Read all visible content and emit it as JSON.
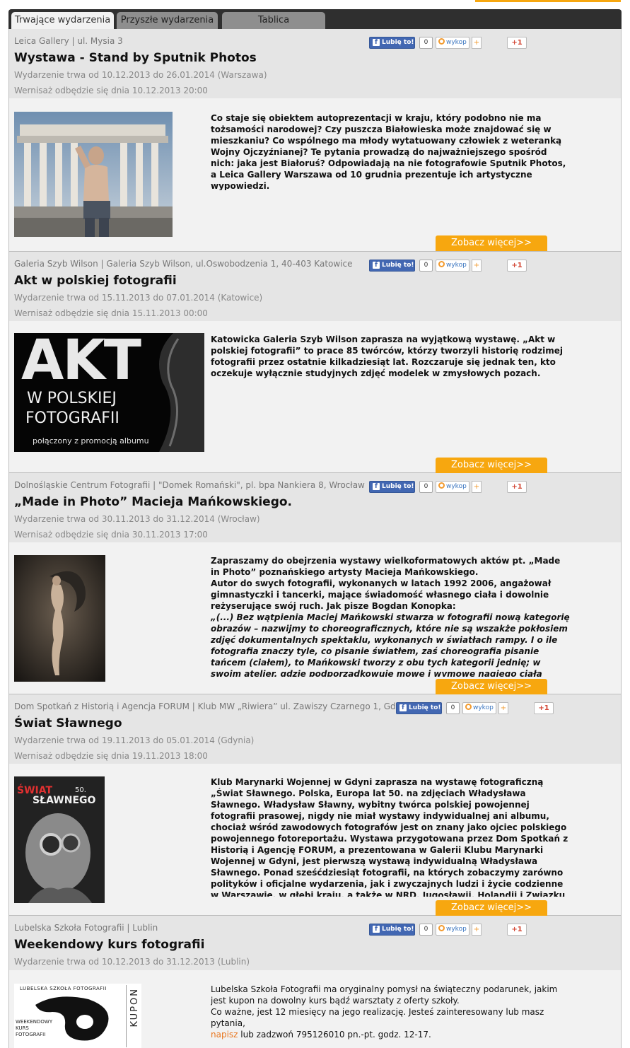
{
  "tabs": [
    "Trwające wydarzenia",
    "Przyszłe wydarzenia",
    "Tablica"
  ],
  "social": {
    "like": "Lubię to!",
    "count": "0",
    "wykop": "wykop",
    "plus": "+",
    "gplus": "+1"
  },
  "more_label": "Zobacz więcej>>",
  "events": [
    {
      "place": "Leica Gallery | ul. Mysia 3",
      "title": "Wystawa - Stand by Sputnik Photos",
      "date": "Wydarzenie trwa od 10.12.2013 do 26.01.2014 (Warszawa)",
      "vernissage": "Wernisaż odbędzie się dnia 10.12.2013 20:00",
      "desc": "Co staje się obiektem autoprezentacji w kraju, który podobno nie ma tożsamości narodowej? Czy puszcza Białowieska może znajdować się w mieszkaniu? Co wspólnego ma młody wytatuowany człowiek z weteranką Wojny Ojczyźnianej? Te pytania prowadzą do najważniejszego spośród nich: jaka jest Białoruś? Odpowiadają na nie fotografowie Sputnik Photos, a Leica Gallery Warszawa od 10 grudnia prezentuje ich artystyczne wypowiedzi."
    },
    {
      "place": "Galeria Szyb Wilson | Galeria Szyb Wilson, ul.Oswobodzenia 1, 40-403 Katowice",
      "title": "Akt w polskiej fotografii",
      "date": "Wydarzenie trwa od 15.11.2013 do 07.01.2014 (Katowice)",
      "vernissage": "Wernisaż odbędzie się dnia 15.11.2013 00:00",
      "desc": "Katowicka Galeria Szyb Wilson zaprasza na wyjątkową wystawę. „Akt w polskiej fotografii” to prace 85 twórców, którzy tworzyli historię rodzimej fotografii przez ostatnie kilkadziesiąt lat. Rozczaruje się jednak ten, kto oczekuje wyłącznie studyjnych zdjęć modelek w zmysłowych pozach.",
      "poster": {
        "l1": "AKT",
        "l2": "W POLSKIEJ",
        "l3": "FOTOGRAFII",
        "l4": "połączony z promocją albumu"
      }
    },
    {
      "place": "Dolnośląskie Centrum Fotografii | \"Domek Romański\", pl. bpa Nankiera 8, Wrocław",
      "title": "„Made in Photo” Macieja Mańkowskiego.",
      "date": "Wydarzenie trwa od 30.11.2013 do 31.12.2014 (Wrocław)",
      "vernissage": "Wernisaż odbędzie się dnia 30.11.2013 17:00",
      "desc_a": "Zapraszamy do obejrzenia wystawy wielkoformatowych aktów pt. „Made in Photo” poznańskiego artysty Macieja Mańkowskiego.",
      "desc_b": "Autor do swych fotografii, wykonanych w latach 1992 2006, angażował gimnastyczki i tancerki, mające świadomość własnego ciała i dowolnie reżyserujące swój ruch. Jak pisze Bogdan Konopka:",
      "desc_c": "„(...) Bez wątpienia Maciej Mańkowski stwarza w fotografii nową kategorię obrazów – nazwijmy to choreograficznych, które nie są wszakże pokłosiem zdjęć dokumentalnych spektaklu, wykonanych w światłach rampy. I o ile fotografia znaczy tyle, co pisanie światłem, zaś choreografia pisanie tańcem (ciałem), to Mańkowski tworzy z obu tych kategorii jednię; w swoim atelier, gdzie podporządkowuje mowę i wymowę nagiego ciała regułom fotografii"
    },
    {
      "place": "Dom Spotkań z Historią i Agencja FORUM | Klub MW „Riwiera” ul. Zawiszy Czarnego 1, Gdynia",
      "title": "Świat Sławnego",
      "date": "Wydarzenie trwa od 19.11.2013 do 05.01.2014 (Gdynia)",
      "vernissage": "Wernisaż odbędzie się dnia 19.11.2013 18:00",
      "desc": "Klub Marynarki Wojennej w Gdyni zaprasza na wystawę fotograficzną „Świat Sławnego. Polska, Europa lat 50. na zdjęciach Władysława Sławnego. Władysław Sławny, wybitny twórca polskiej powojennej fotografii prasowej, nigdy nie miał wystawy indywidualnej ani albumu, chociaż wśród zawodowych fotografów jest on znany jako ojciec polskiego powojennego fotoreportażu. Wystawa przygotowana przez Dom Spotkań z Historią i Agencję FORUM, a prezentowana w Galerii Klubu Marynarki Wojennej w Gdyni, jest pierwszą wystawą indywidualną Władysława Sławnego. Ponad sześćdziesiąt fotografii, na których zobaczymy zarówno polityków i oficjalne wydarzenia, jak i zwyczajnych ludzi i życie codzienne w Warszawie, w głębi kraju, a także w NRD, Jugosławii, Holandii i Związku Radzieckim. Sławny fotografował też w Gdyni",
      "poster": {
        "l1": "ŚWIAT",
        "l2": "SŁAWNEGO",
        "l3": "50."
      }
    },
    {
      "place": "Lubelska Szkoła Fotografii | Lublin",
      "title": "Weekendowy kurs fotografii",
      "date": "Wydarzenie trwa od 10.12.2013 do 31.12.2013 (Lublin)",
      "desc_a": "Lubelska Szkoła Fotografii ma oryginalny pomysł na świąteczny podarunek, jakim jest kupon na dowolny kurs bądź warsztaty z oferty szkoły.",
      "desc_b": "Co ważne, jest 12 miesięcy na jego realizację. Jesteś zainteresowany lub masz pytania,",
      "link": "napisz",
      "desc_c": "lub zadzwoń 795126010 pn.-pt. godz. 12-17.",
      "poster": {
        "l1": "LUBELSKA SZKOŁA FOTOGRAFII",
        "l2": "WEEKENDOWY",
        "l3": "KURS",
        "l4": "FOTOGRAFII",
        "l5": "KUPON"
      }
    }
  ]
}
